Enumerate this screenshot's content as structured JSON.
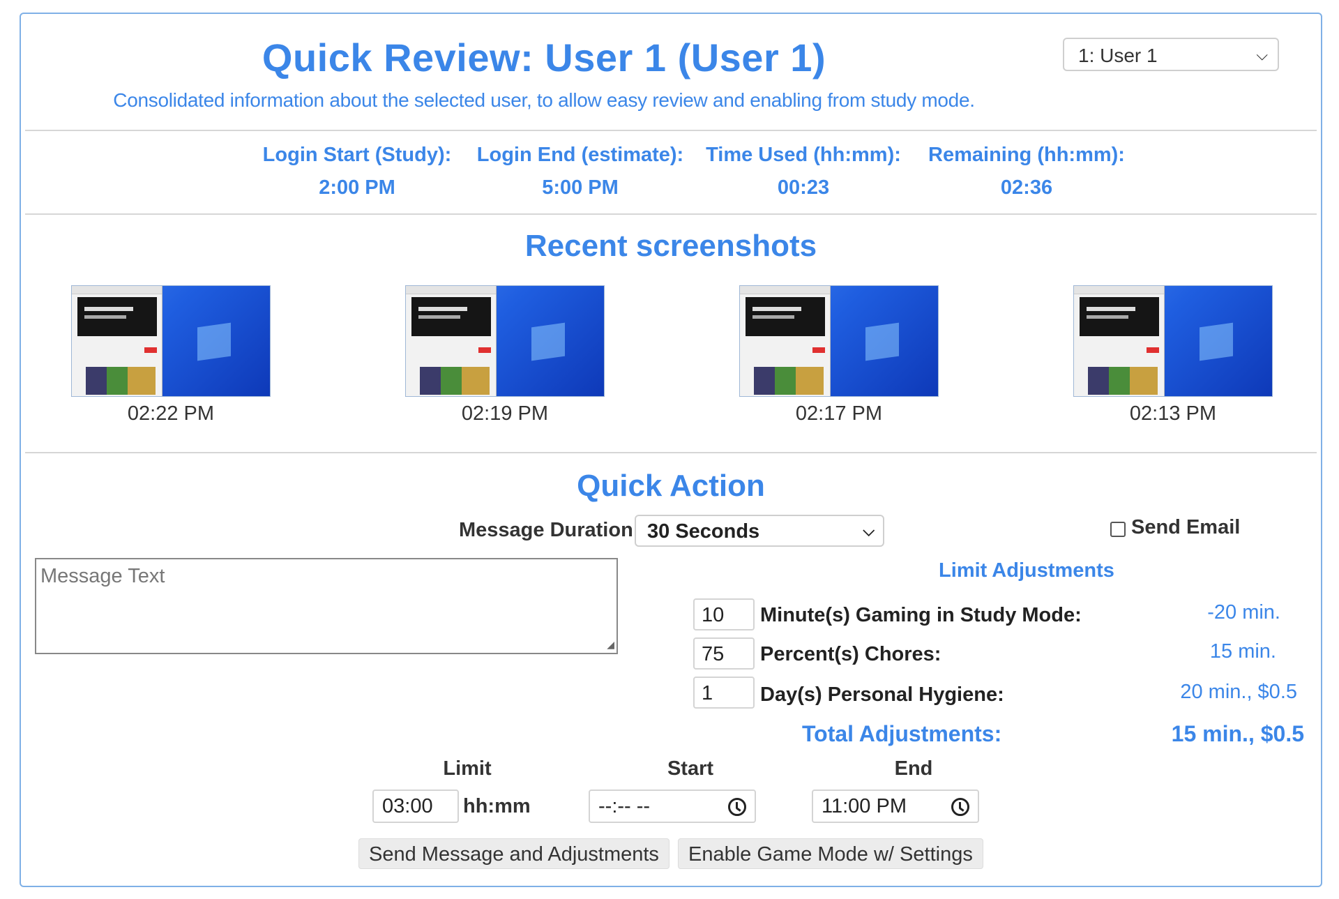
{
  "header": {
    "title": "Quick Review: User 1 (User 1)",
    "subtitle": "Consolidated information about the selected user, to allow easy review and enabling from study mode.",
    "user_select": "1: User 1"
  },
  "stats": [
    {
      "label": "Login Start (Study):",
      "value": "2:00 PM"
    },
    {
      "label": "Login End (estimate):",
      "value": "5:00 PM"
    },
    {
      "label": "Time Used (hh:mm):",
      "value": "00:23"
    },
    {
      "label": "Remaining (hh:mm):",
      "value": "02:36"
    }
  ],
  "screenshots": {
    "title": "Recent screenshots",
    "items": [
      {
        "time": "02:22 PM"
      },
      {
        "time": "02:19 PM"
      },
      {
        "time": "02:17 PM"
      },
      {
        "time": "02:13 PM"
      }
    ]
  },
  "quick_action": {
    "title": "Quick Action",
    "duration_label": "Message Duration",
    "duration_value": "30 Seconds",
    "send_email_label": "Send Email",
    "message_placeholder": "Message Text"
  },
  "limit_adjustments": {
    "title": "Limit Adjustments",
    "rows": [
      {
        "value": "10",
        "label": "Minute(s) Gaming in Study Mode:",
        "result": "-20 min."
      },
      {
        "value": "75",
        "label": "Percent(s) Chores:",
        "result": "15 min."
      },
      {
        "value": "1",
        "label": "Day(s) Personal Hygiene:",
        "result": "20 min., $0.5"
      }
    ],
    "total_label": "Total Adjustments:",
    "total_value": "15 min., $0.5"
  },
  "times": {
    "limit_label": "Limit",
    "limit_value": "03:00",
    "limit_unit": "hh:mm",
    "start_label": "Start",
    "start_value": "--:-- --",
    "end_label": "End",
    "end_value": "11:00 PM"
  },
  "buttons": {
    "send": "Send Message and Adjustments",
    "enable": "Enable Game Mode w/ Settings"
  },
  "colors": {
    "accent": "#3b86e8",
    "border": "#7fb0e6"
  }
}
